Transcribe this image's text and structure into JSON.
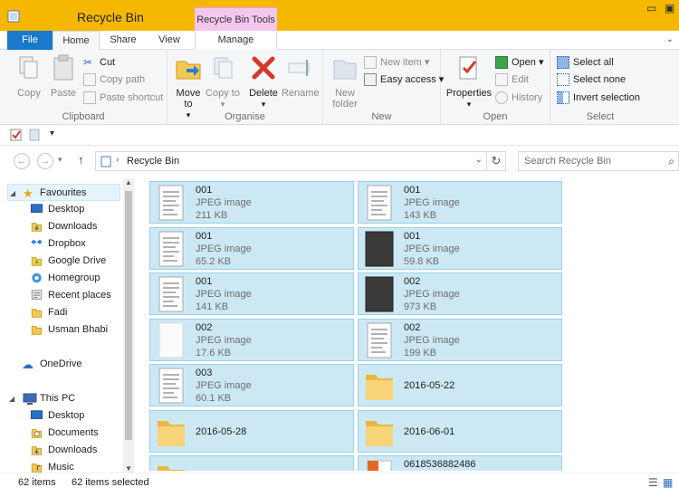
{
  "window": {
    "title": "Recycle Bin",
    "contextual_tab": "Recycle Bin Tools"
  },
  "tabs": {
    "file": "File",
    "home": "Home",
    "share": "Share",
    "view": "View",
    "manage": "Manage"
  },
  "ribbon": {
    "clipboard": {
      "label": "Clipboard",
      "copy": "Copy",
      "paste": "Paste",
      "cut": "Cut",
      "copy_path": "Copy path",
      "paste_shortcut": "Paste shortcut"
    },
    "organise": {
      "label": "Organise",
      "move_to": "Move to",
      "copy_to": "Copy to",
      "delete": "Delete",
      "rename": "Rename"
    },
    "new": {
      "label": "New",
      "new_folder": "New folder",
      "new_item": "New item",
      "easy_access": "Easy access"
    },
    "open": {
      "label": "Open",
      "properties": "Properties",
      "open": "Open",
      "edit": "Edit",
      "history": "History"
    },
    "select": {
      "label": "Select",
      "select_all": "Select all",
      "select_none": "Select none",
      "invert": "Invert selection"
    }
  },
  "address": {
    "crumb": "Recycle Bin",
    "search_placeholder": "Search Recycle Bin"
  },
  "nav": {
    "favourites": "Favourites",
    "fav_items": [
      "Desktop",
      "Downloads",
      "Dropbox",
      "Google Drive",
      "Homegroup",
      "Recent places",
      "Fadi",
      "Usman Bhabi"
    ],
    "onedrive": "OneDrive",
    "thispc": "This PC",
    "pc_items": [
      "Desktop",
      "Documents",
      "Downloads",
      "Music"
    ]
  },
  "files": [
    {
      "name": "001",
      "type": "JPEG image",
      "size": "211 KB",
      "thumb": "doc"
    },
    {
      "name": "001",
      "type": "JPEG image",
      "size": "143 KB",
      "thumb": "doc"
    },
    {
      "name": "001",
      "type": "JPEG image",
      "size": "65.2 KB",
      "thumb": "doc"
    },
    {
      "name": "001",
      "type": "JPEG image",
      "size": "59.8 KB",
      "thumb": "dark"
    },
    {
      "name": "001",
      "type": "JPEG image",
      "size": "141 KB",
      "thumb": "doc"
    },
    {
      "name": "002",
      "type": "JPEG image",
      "size": "973 KB",
      "thumb": "dark"
    },
    {
      "name": "002",
      "type": "JPEG image",
      "size": "17.6 KB",
      "thumb": "blank"
    },
    {
      "name": "002",
      "type": "JPEG image",
      "size": "199 KB",
      "thumb": "doc"
    },
    {
      "name": "003",
      "type": "JPEG image",
      "size": "60.1 KB",
      "thumb": "doc"
    },
    {
      "name": "2016-05-22",
      "type": "",
      "size": "",
      "thumb": "folder"
    },
    {
      "name": "2016-05-28",
      "type": "",
      "size": "",
      "thumb": "folder"
    },
    {
      "name": "2016-06-01",
      "type": "",
      "size": "",
      "thumb": "folder"
    },
    {
      "name": "",
      "type": "",
      "size": "",
      "thumb": "folder"
    },
    {
      "name": "0618536882486",
      "type": "",
      "size": "",
      "thumb": "office"
    }
  ],
  "status": {
    "count": "62 items",
    "selected": "62 items selected"
  },
  "colors": {
    "titlebar": "#f5b700",
    "file_tab": "#1979ca",
    "context": "#f4c7ef",
    "selection": "#cce8f4"
  }
}
